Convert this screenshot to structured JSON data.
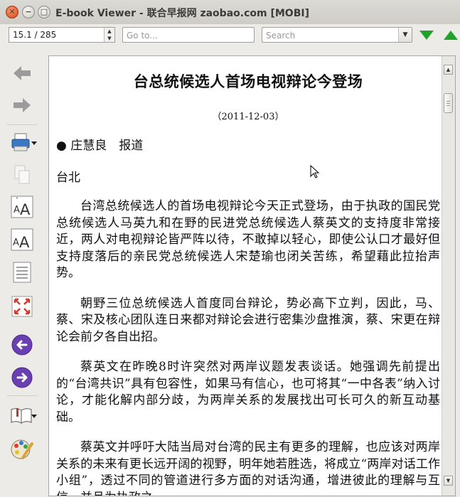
{
  "window": {
    "title": "E-book Viewer - 联合早报网 zaobao.com [MOBI]",
    "close_glyph": "✕",
    "min_glyph": "−",
    "max_glyph": "□"
  },
  "toolbar": {
    "position_value": "15.1 / 285",
    "goto_placeholder": "Go to...",
    "search_placeholder": "Search",
    "spin_up": "▲",
    "spin_down": "▼",
    "dropdown_glyph": "▼"
  },
  "sidebar": {
    "tools": [
      "back-icon",
      "forward-icon",
      "print-icon",
      "copy-icon",
      "font-larger-icon",
      "font-smaller-icon",
      "toc-icon",
      "fullscreen-icon",
      "previous-page-icon",
      "next-page-icon",
      "bookmarks-icon",
      "preferences-icon"
    ]
  },
  "article": {
    "title": "台总统候选人首场电视辩论今登场",
    "date": "（2011-12-03）",
    "byline": "● 庄慧良　报道",
    "place": "台北",
    "paragraphs": [
      "台湾总统候选人的首场电视辩论今天正式登场，由于执政的国民党总统候选人马英九和在野的民进党总统候选人蔡英文的支持度非常接近，两人对电视辩论皆严阵以待，不敢掉以轻心，即使公认口才最好但支持度落后的亲民党总统候选人宋楚瑜也闭关苦练，希望藉此拉抬声势。",
      "朝野三位总统候选人首度同台辩论，势必高下立判，因此，马、蔡、宋及核心团队连日来都对辩论会进行密集沙盘推演，蔡、宋更在辩论会前夕各自出招。",
      "蔡英文在昨晚8时许突然对两岸议题发表谈话。她强调先前提出的“台湾共识”具有包容性，如果马有信心，也可将其“一中各表”纳入讨论，才能化解内部分歧，为两岸关系的发展找出可长可久的新互动基础。",
      "蔡英文并呼吁大陆当局对台湾的民主有更多的理解，也应该对两岸关系的未来有更长远开阔的视野，明年她若胜选，将成立“两岸对话工作小组”，透过不同的管道进行多方面的对话沟通，增进彼此的理解与互信，并且为执政之"
    ]
  },
  "scrollbar": {
    "up_glyph": "▲",
    "down_glyph": "▼"
  }
}
